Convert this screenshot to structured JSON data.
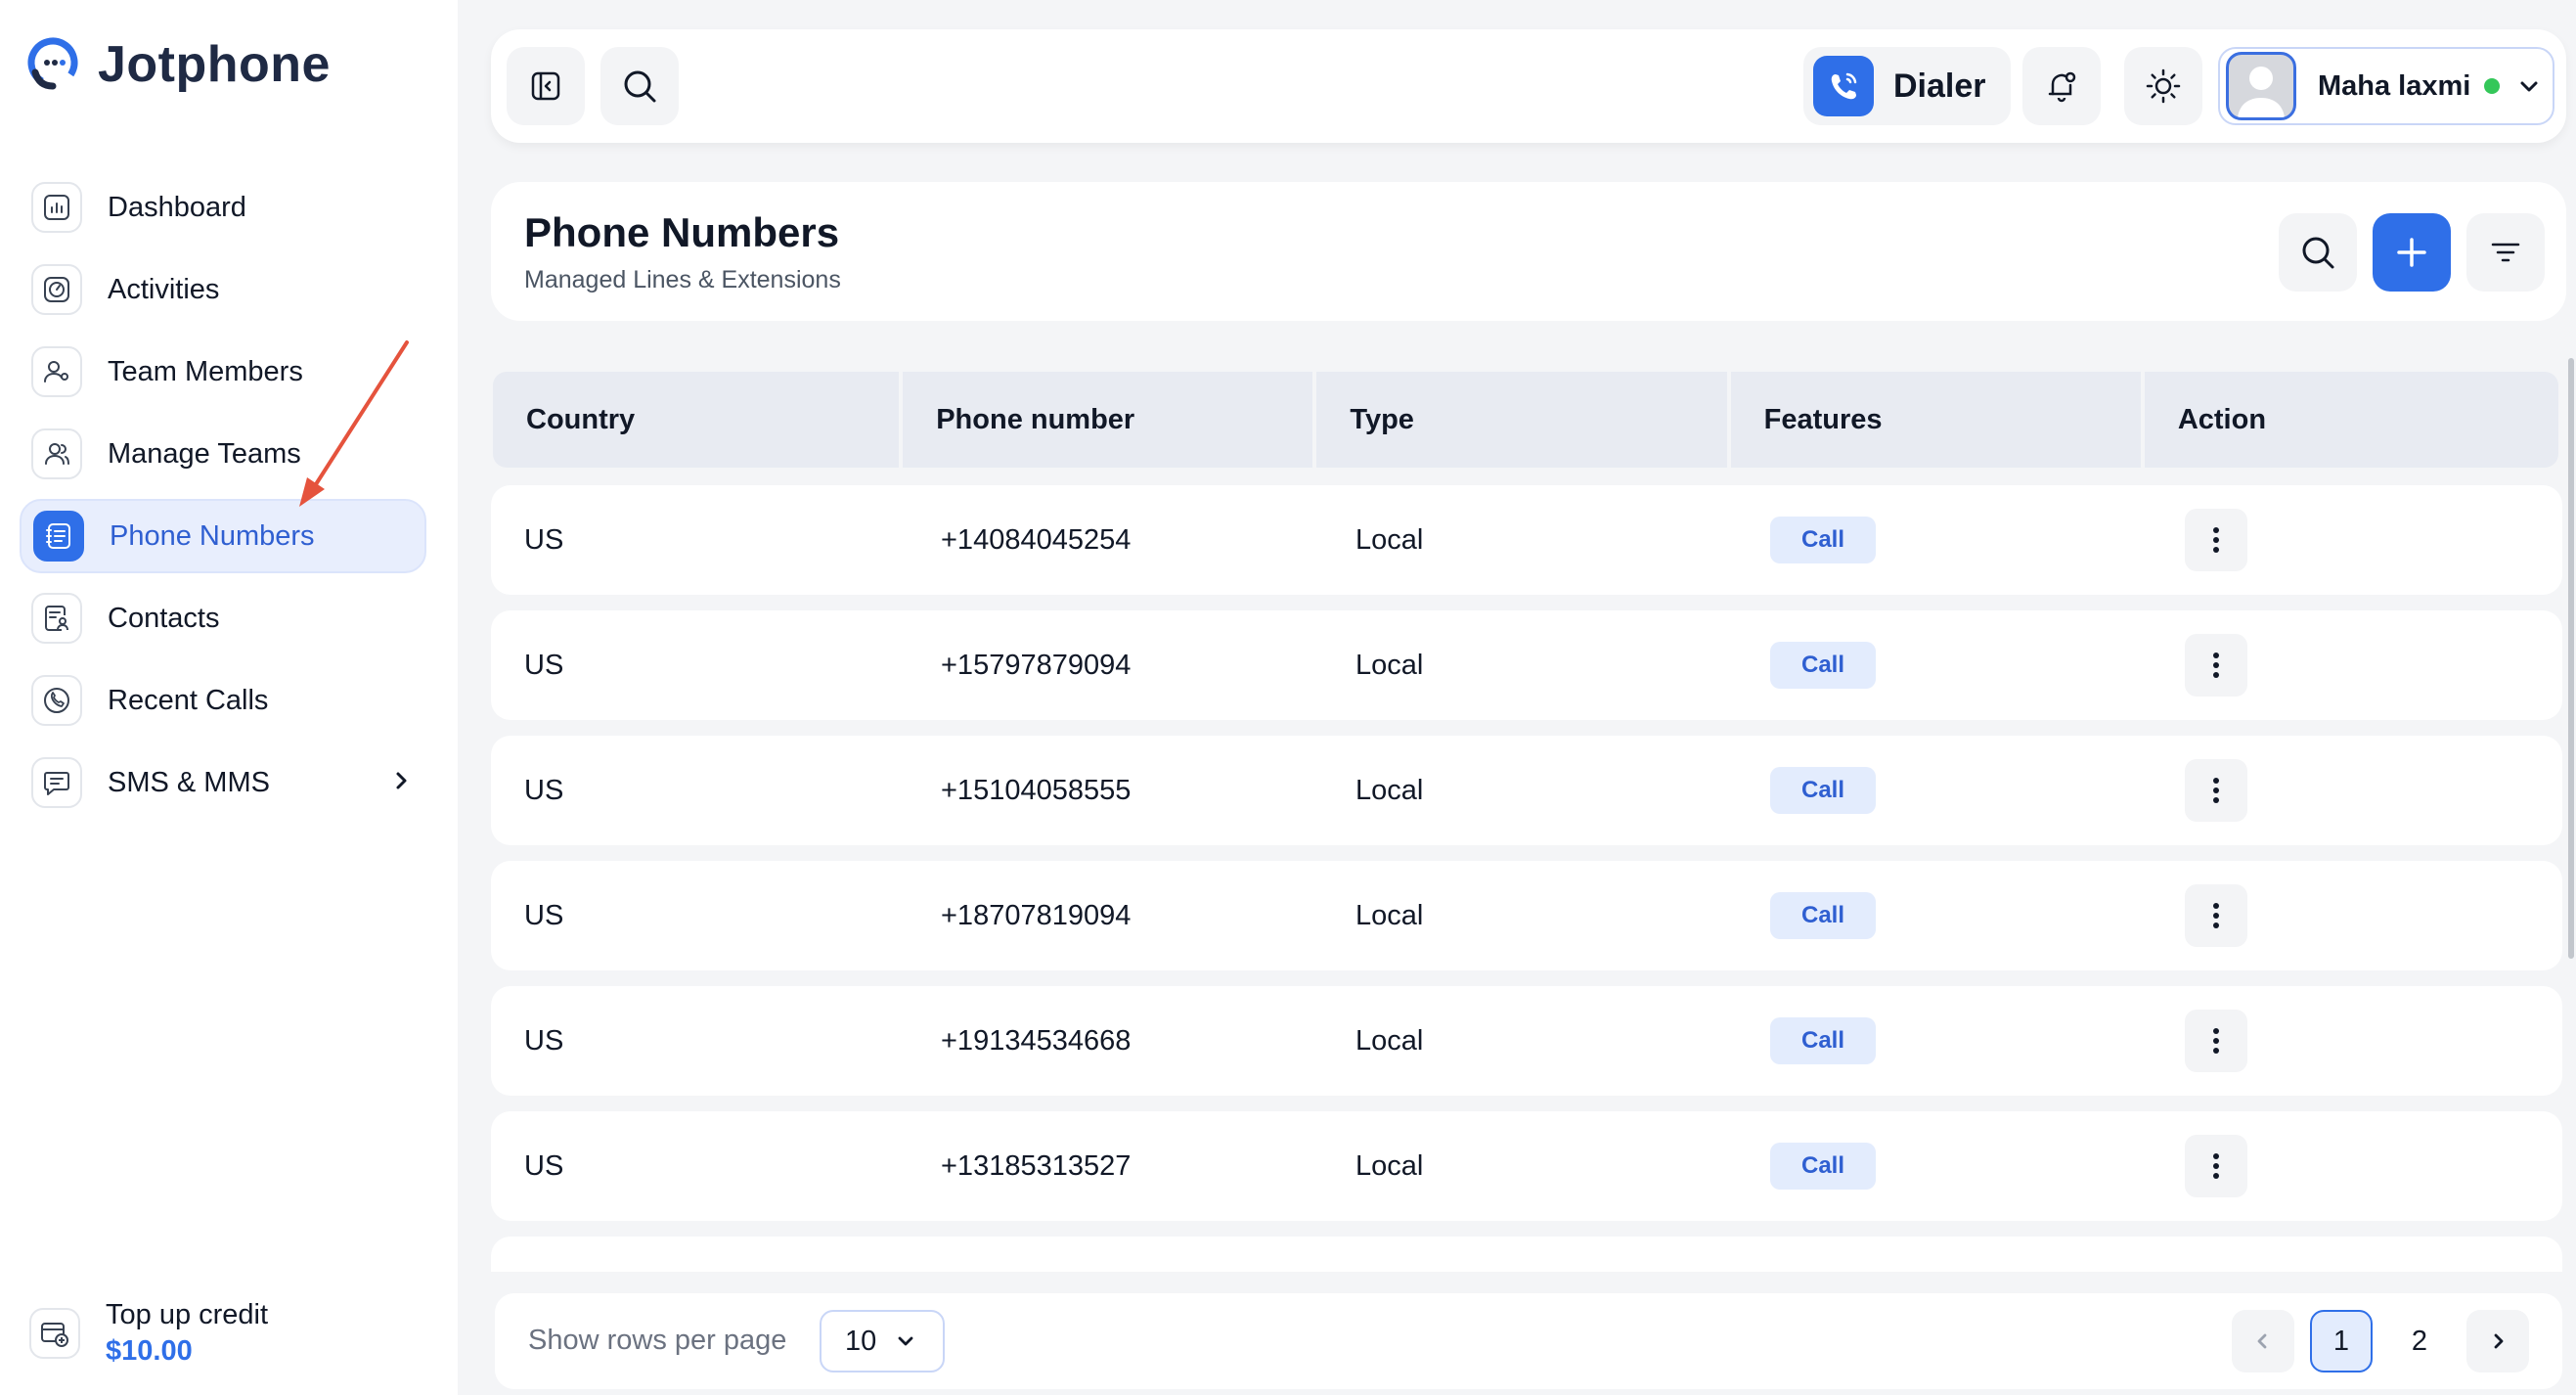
{
  "app": {
    "name": "Jotphone",
    "accent": "#2f6fe8"
  },
  "sidebar": {
    "items": [
      {
        "label": "Dashboard",
        "icon": "chart-icon"
      },
      {
        "label": "Activities",
        "icon": "activity-icon"
      },
      {
        "label": "Team Members",
        "icon": "team-member-icon"
      },
      {
        "label": "Manage Teams",
        "icon": "users-icon"
      },
      {
        "label": "Phone Numbers",
        "icon": "phone-book-icon",
        "active": true
      },
      {
        "label": "Contacts",
        "icon": "contacts-icon"
      },
      {
        "label": "Recent Calls",
        "icon": "recent-calls-icon"
      },
      {
        "label": "SMS & MMS",
        "icon": "message-icon",
        "has_submenu": true
      }
    ],
    "topup": {
      "label": "Top up credit",
      "amount": "$10.00",
      "icon": "wallet-icon"
    }
  },
  "topbar": {
    "dialer_label": "Dialer",
    "user_name": "Maha laxmi",
    "user_status_color": "#34c759"
  },
  "page": {
    "title": "Phone Numbers",
    "subtitle": "Managed Lines & Extensions"
  },
  "table": {
    "columns": [
      "Country",
      "Phone number",
      "Type",
      "Features",
      "Action"
    ],
    "rows": [
      {
        "country": "US",
        "phone": "+14084045254",
        "type": "Local",
        "feature": "Call"
      },
      {
        "country": "US",
        "phone": "+15797879094",
        "type": "Local",
        "feature": "Call"
      },
      {
        "country": "US",
        "phone": "+15104058555",
        "type": "Local",
        "feature": "Call"
      },
      {
        "country": "US",
        "phone": "+18707819094",
        "type": "Local",
        "feature": "Call"
      },
      {
        "country": "US",
        "phone": "+19134534668",
        "type": "Local",
        "feature": "Call"
      },
      {
        "country": "US",
        "phone": "+13185313527",
        "type": "Local",
        "feature": "Call"
      }
    ]
  },
  "pagination": {
    "rows_label": "Show rows per page",
    "rows_value": "10",
    "pages": [
      "1",
      "2"
    ],
    "current_page": "1"
  }
}
